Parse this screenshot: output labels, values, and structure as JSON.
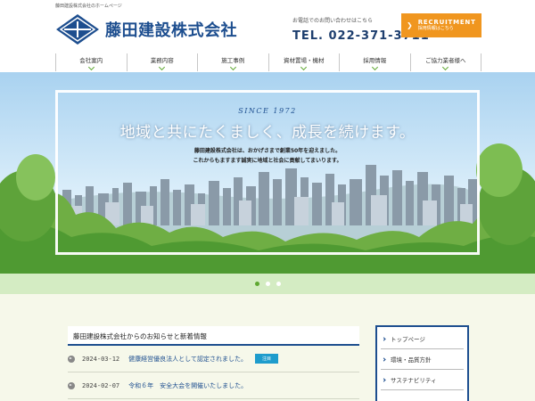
{
  "header": {
    "tagline": "藤田建設株式会社のホームページ",
    "company_name": "藤田建設株式会社",
    "contact_note": "お電話でのお問い合わせはこちら",
    "phone": "TEL. 022-371-3711",
    "recruit_title": "RECRUITMENT",
    "recruit_sub": "採用情報はこちら",
    "recruit_arrow": "❯"
  },
  "nav": {
    "items": [
      {
        "label": "会社案内"
      },
      {
        "label": "業務内容"
      },
      {
        "label": "施工事例"
      },
      {
        "label": "資材置場・機材"
      },
      {
        "label": "採用情報"
      },
      {
        "label": "ご協力業者様へ"
      }
    ]
  },
  "hero": {
    "since": "SINCE 1972",
    "headline": "地域と共にたくましく、成長を続けます。",
    "sub_line1": "藤田建設株式会社は、おかげさまで創業50年を迎えました。",
    "sub_line2": "これからもますます誠実に地域と社会に貢献してまいります。",
    "slide_count": 3,
    "active_slide": 1
  },
  "news": {
    "heading": "藤田建設株式会社からのお知らせと新着情報",
    "items": [
      {
        "date": "2024-03-12",
        "title": "健康経営優良法人として認定されました。",
        "badge": "注目"
      },
      {
        "date": "2024-02-07",
        "title": "令和６年　安全大会を開催いたしました。",
        "badge": ""
      }
    ]
  },
  "sidebar": {
    "items": [
      {
        "label": "トップページ"
      },
      {
        "label": "環境・品質方針"
      },
      {
        "label": "サステナビリティ"
      }
    ]
  },
  "colors": {
    "brand_blue": "#1d4e8f",
    "accent_orange": "#f0961f",
    "accent_green": "#5fa832",
    "badge_blue": "#1e9ccc"
  }
}
